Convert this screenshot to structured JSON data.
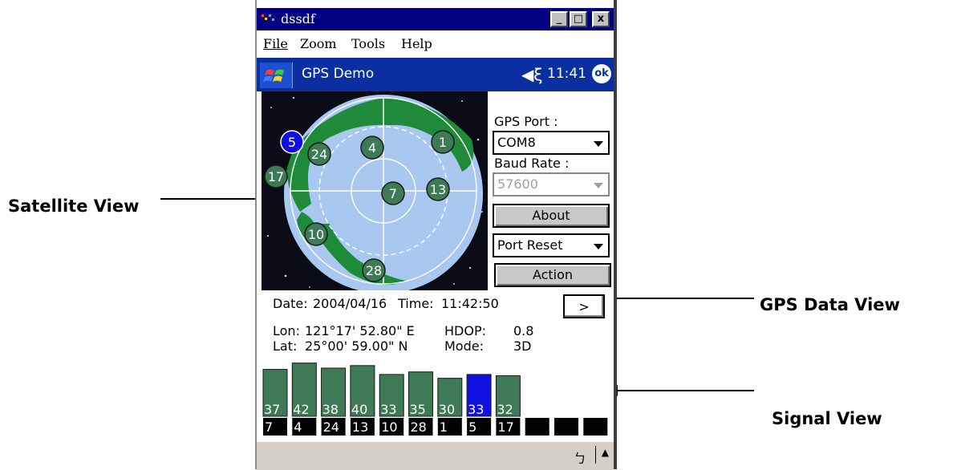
{
  "window": {
    "title": "dssdf",
    "controls": [
      "_",
      "□",
      "x"
    ]
  },
  "menu": {
    "items": [
      "File",
      "Zoom",
      "Tools",
      "Help"
    ]
  },
  "taskbar": {
    "program": "GPS Demo",
    "time": "11:41",
    "ok": "ok"
  },
  "panel": {
    "gps_port_label": "GPS Port :",
    "gps_port_value": "COM8",
    "baud_rate_label": "Baud Rate :",
    "baud_rate_value": "57600",
    "about_button": "About",
    "port_reset_value": "Port Reset",
    "action_button": "Action"
  },
  "gps_data": {
    "date_label": "Date:",
    "date": "2004/04/16",
    "time_label": "Time:",
    "time": "11:42:50",
    "more_button": ">",
    "lon_label": "Lon:",
    "lon": "121°17' 52.80\" E",
    "hdop_label": "HDOP:",
    "hdop": "0.8",
    "lat_label": "Lat:",
    "lat": "25°00' 59.00\" N",
    "mode_label": "Mode:",
    "mode": "3D"
  },
  "satellites": [
    {
      "id": "5",
      "highlight": true
    },
    {
      "id": "24"
    },
    {
      "id": "4"
    },
    {
      "id": "1"
    },
    {
      "id": "17"
    },
    {
      "id": "7"
    },
    {
      "id": "13"
    },
    {
      "id": "10"
    },
    {
      "id": "28"
    }
  ],
  "signals": [
    {
      "sat": "7",
      "snr": 37
    },
    {
      "sat": "4",
      "snr": 42
    },
    {
      "sat": "24",
      "snr": 38
    },
    {
      "sat": "13",
      "snr": 40
    },
    {
      "sat": "10",
      "snr": 33
    },
    {
      "sat": "28",
      "snr": 35
    },
    {
      "sat": "1",
      "snr": 30
    },
    {
      "sat": "5",
      "snr": 33,
      "highlight": true
    },
    {
      "sat": "17",
      "snr": 32
    },
    {
      "sat": "",
      "snr": 0
    },
    {
      "sat": "",
      "snr": 0
    },
    {
      "sat": "",
      "snr": 0
    }
  ],
  "annotations": {
    "satellite_view": "Satellite View",
    "gps_data_view": "GPS Data View",
    "signal_view": "Signal View"
  },
  "colors": {
    "sat_green": "#3d7a55",
    "highlight_blue": "#1010e0",
    "ocean": "#a8c8f0",
    "land": "#1f8a3a"
  }
}
